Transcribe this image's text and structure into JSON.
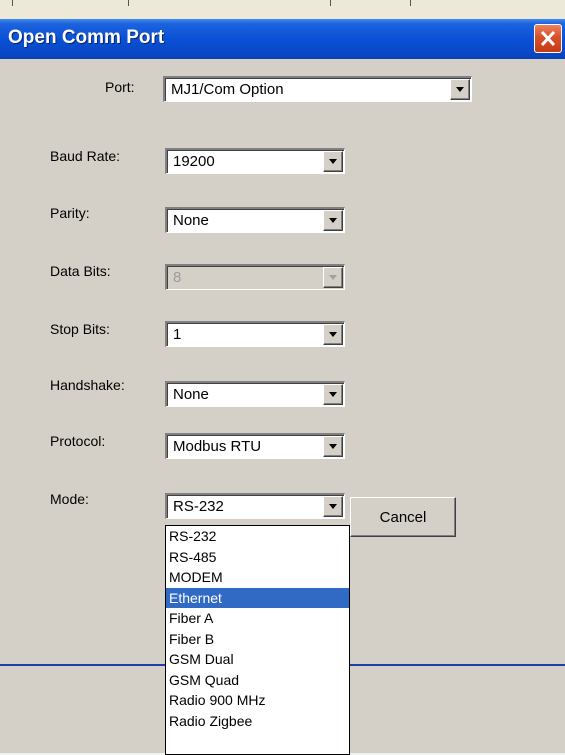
{
  "window": {
    "title": "Open Comm Port"
  },
  "fields": {
    "port": {
      "label": "Port:",
      "value": "MJ1/Com Option"
    },
    "baud_rate": {
      "label": "Baud Rate:",
      "value": "19200"
    },
    "parity": {
      "label": "Parity:",
      "value": "None"
    },
    "data_bits": {
      "label": "Data Bits:",
      "value": "8",
      "disabled": true
    },
    "stop_bits": {
      "label": "Stop Bits:",
      "value": "1"
    },
    "handshake": {
      "label": "Handshake:",
      "value": "None"
    },
    "protocol": {
      "label": "Protocol:",
      "value": "Modbus RTU"
    },
    "mode": {
      "label": "Mode:",
      "value": "RS-232"
    }
  },
  "buttons": {
    "cancel": "Cancel"
  },
  "mode_dropdown": {
    "highlighted": "Ethernet",
    "options": [
      "RS-232",
      "RS-485",
      "MODEM",
      "Ethernet",
      "Fiber A",
      "Fiber B",
      "GSM Dual",
      "GSM Quad",
      "Radio 900 MHz",
      "Radio Zigbee"
    ]
  },
  "colors": {
    "title_bar": "#0a51d6",
    "close_button": "#d9502a",
    "dialog_bg": "#d4d0c8",
    "selection": "#316ac5",
    "divider": "#1c3fa8"
  }
}
